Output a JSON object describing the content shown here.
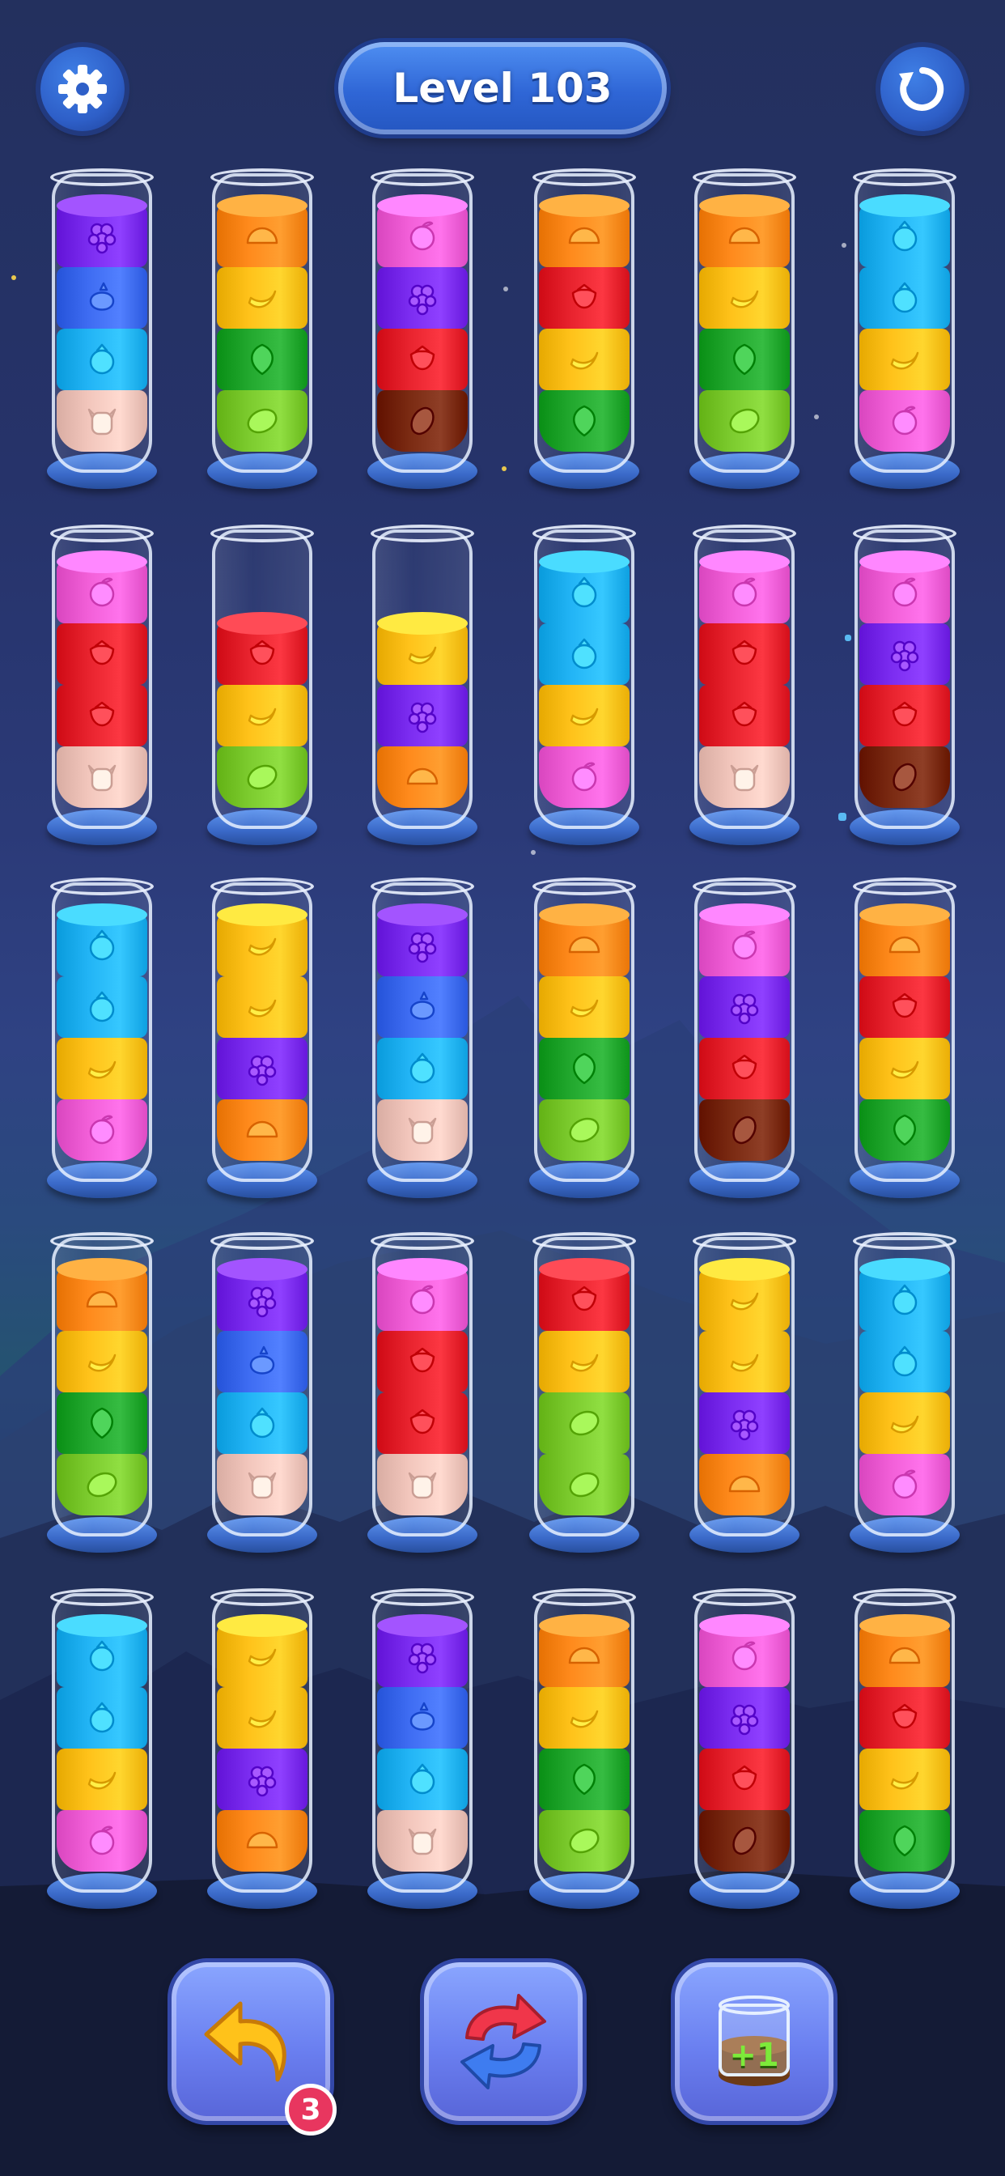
{
  "header": {
    "level_label": "Level 103"
  },
  "colors": {
    "purple": "#7b2cf0",
    "blue": "#3e6cf2",
    "cyan": "#22b4f5",
    "peach": "#f2c6bc",
    "orange": "#ff8a1c",
    "yellow": "#ffc21a",
    "green": "#22a82e",
    "lime": "#7ccb2e",
    "pink": "#f25fd8",
    "red": "#e8232e",
    "brown": "#7a2a12"
  },
  "icons": {
    "purple": "grapes-icon",
    "blue": "blueberry-icon",
    "cyan": "berry-icon",
    "peach": "cow-icon",
    "orange": "orange-slice-icon",
    "yellow": "banana-icon",
    "green": "leaf-icon",
    "lime": "lime-icon",
    "pink": "peach-icon",
    "red": "strawberry-icon",
    "brown": "coffee-bean-icon"
  },
  "tubes": [
    [
      "purple",
      "blue",
      "cyan",
      "peach"
    ],
    [
      "orange",
      "yellow",
      "green",
      "lime"
    ],
    [
      "pink",
      "purple",
      "red",
      "brown"
    ],
    [
      "orange",
      "red",
      "yellow",
      "green"
    ],
    [
      "orange",
      "yellow",
      "green",
      "lime"
    ],
    [
      "cyan",
      "cyan",
      "yellow",
      "pink"
    ],
    [
      "pink",
      "red",
      "red",
      "peach"
    ],
    [
      "red",
      "yellow",
      "lime"
    ],
    [
      "yellow",
      "purple",
      "orange"
    ],
    [
      "cyan",
      "cyan",
      "yellow",
      "pink"
    ],
    [
      "pink",
      "red",
      "red",
      "peach"
    ],
    [
      "pink",
      "purple",
      "red",
      "brown"
    ],
    [
      "cyan",
      "cyan",
      "yellow",
      "pink"
    ],
    [
      "yellow",
      "yellow",
      "purple",
      "orange"
    ],
    [
      "purple",
      "blue",
      "cyan",
      "peach"
    ],
    [
      "orange",
      "yellow",
      "green",
      "lime"
    ],
    [
      "pink",
      "purple",
      "red",
      "brown"
    ],
    [
      "orange",
      "red",
      "yellow",
      "green"
    ],
    [
      "orange",
      "yellow",
      "green",
      "lime"
    ],
    [
      "purple",
      "blue",
      "cyan",
      "peach"
    ],
    [
      "pink",
      "red",
      "red",
      "peach"
    ],
    [
      "red",
      "yellow",
      "lime",
      "lime"
    ],
    [
      "yellow",
      "yellow",
      "purple",
      "orange"
    ],
    [
      "cyan",
      "cyan",
      "yellow",
      "pink"
    ],
    [
      "cyan",
      "cyan",
      "yellow",
      "pink"
    ],
    [
      "yellow",
      "yellow",
      "purple",
      "orange"
    ],
    [
      "purple",
      "blue",
      "cyan",
      "peach"
    ],
    [
      "orange",
      "yellow",
      "green",
      "lime"
    ],
    [
      "pink",
      "purple",
      "red",
      "brown"
    ],
    [
      "orange",
      "red",
      "yellow",
      "green"
    ]
  ],
  "boosters": {
    "undo_icon": "undo-arrow-icon",
    "undo_count": "3",
    "shuffle_icon": "shuffle-arrows-icon",
    "add_tube_icon": "add-tube-icon",
    "add_tube_label": "+1"
  }
}
